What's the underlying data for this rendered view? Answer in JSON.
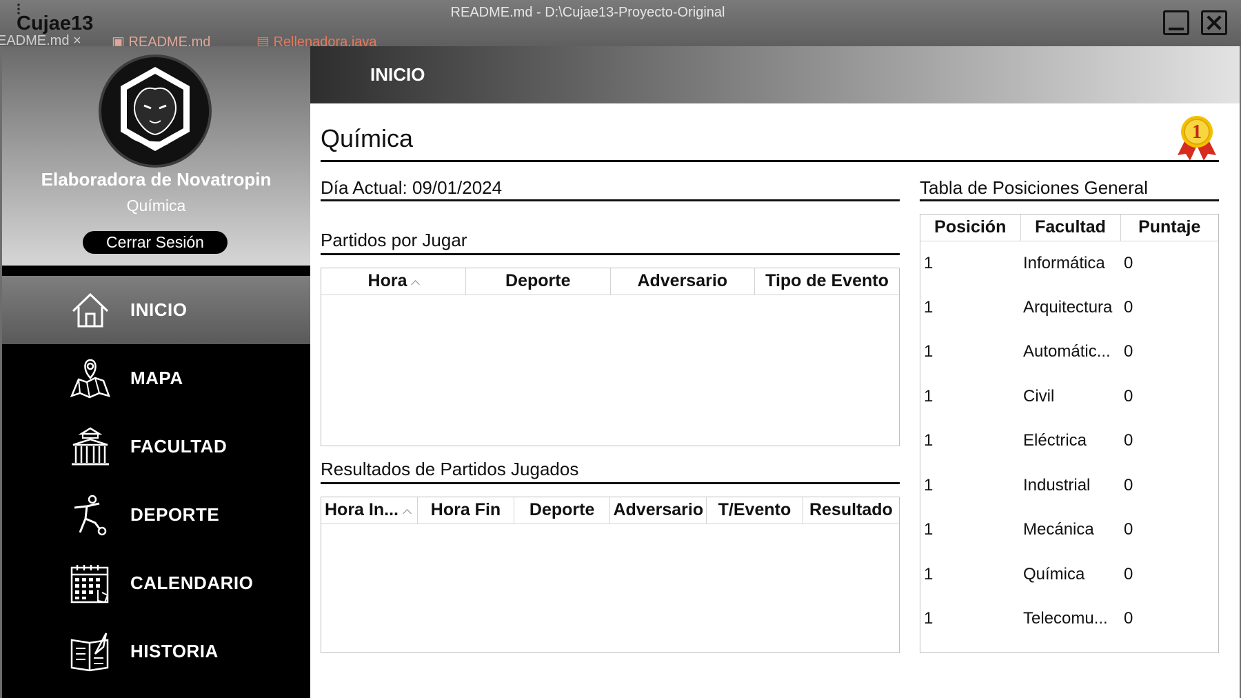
{
  "window": {
    "app_title": "Cujae13",
    "file_title": "README.md - D:\\Cujae13-Proyecto-Original",
    "bg_tabs": [
      "EADME.md  ×",
      "README.md",
      "Rellenadora.java"
    ]
  },
  "sidebar": {
    "user_name": "Elaboradora de Novatropin",
    "user_faculty": "Química",
    "logout_label": "Cerrar Sesión",
    "items": [
      {
        "label": "INICIO",
        "icon": "home-icon",
        "active": true
      },
      {
        "label": "MAPA",
        "icon": "map-icon",
        "active": false
      },
      {
        "label": "FACULTAD",
        "icon": "faculty-building-icon",
        "active": false
      },
      {
        "label": "DEPORTE",
        "icon": "sport-player-icon",
        "active": false
      },
      {
        "label": "CALENDARIO",
        "icon": "calendar-icon",
        "active": false
      },
      {
        "label": "HISTORIA",
        "icon": "history-book-icon",
        "active": false
      }
    ]
  },
  "header": {
    "title": "INICIO"
  },
  "main": {
    "faculty_title": "Química",
    "current_day": "Día Actual: 09/01/2024",
    "pending_title": "Partidos por Jugar",
    "pending_columns": [
      "Hora",
      "Deporte",
      "Adversario",
      "Tipo de Evento"
    ],
    "results_title": "Resultados de Partidos Jugados",
    "results_columns": [
      "Hora In...",
      "Hora Fin",
      "Deporte",
      "Adversario",
      "T/Evento",
      "Resultado"
    ],
    "standings_title": "Tabla de Posiciones General",
    "standings_columns": [
      "Posición",
      "Facultad",
      "Puntaje"
    ],
    "standings_rows": [
      {
        "pos": "1",
        "fac": "Informática",
        "pts": "0"
      },
      {
        "pos": "1",
        "fac": "Arquitectura",
        "pts": "0"
      },
      {
        "pos": "1",
        "fac": "Automátic...",
        "pts": "0"
      },
      {
        "pos": "1",
        "fac": "Civil",
        "pts": "0"
      },
      {
        "pos": "1",
        "fac": "Eléctrica",
        "pts": "0"
      },
      {
        "pos": "1",
        "fac": "Industrial",
        "pts": "0"
      },
      {
        "pos": "1",
        "fac": "Mecánica",
        "pts": "0"
      },
      {
        "pos": "1",
        "fac": "Química",
        "pts": "0"
      },
      {
        "pos": "1",
        "fac": "Telecomu...",
        "pts": "0"
      }
    ],
    "medal_number": "1"
  }
}
